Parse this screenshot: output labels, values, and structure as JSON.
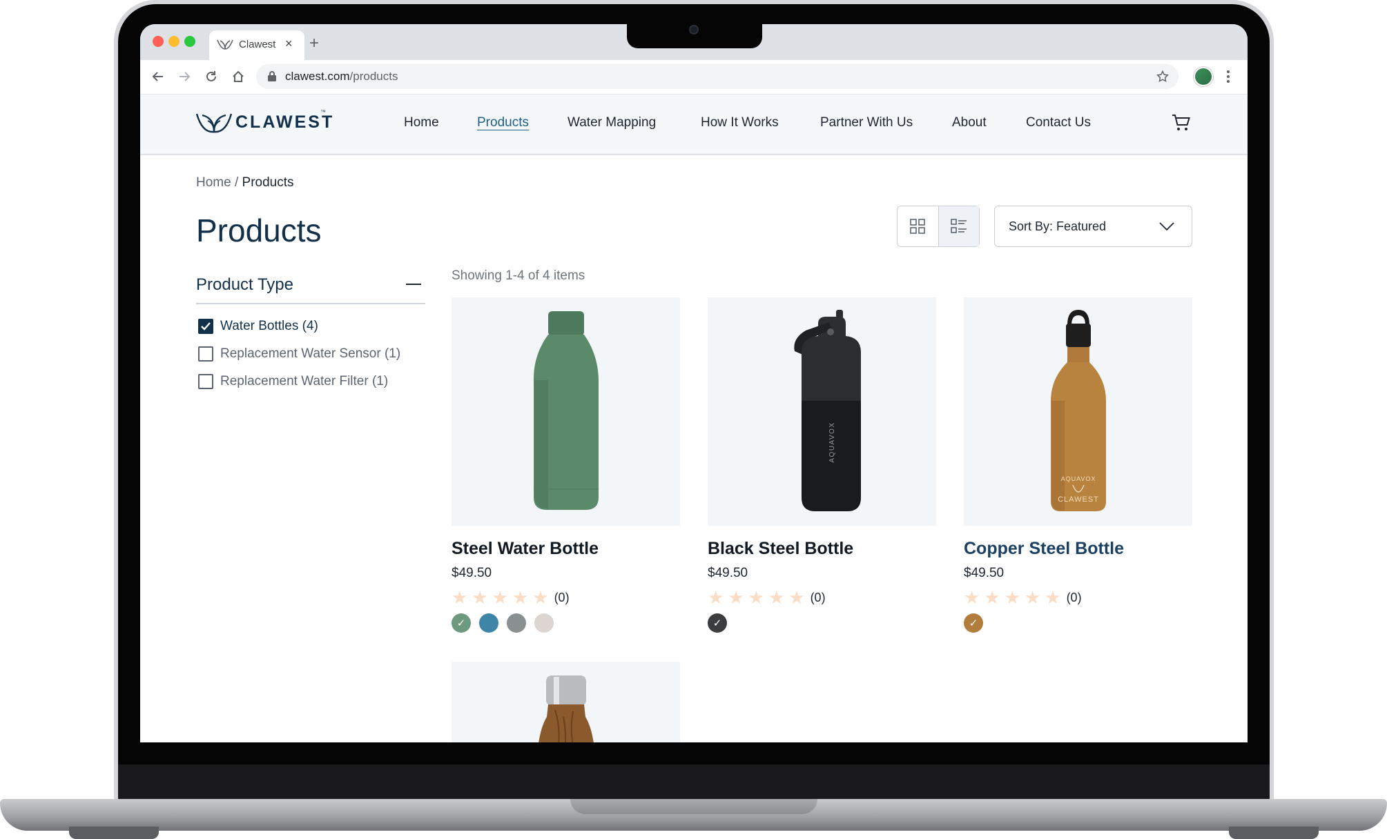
{
  "browser": {
    "tab_title": "Clawest",
    "tab_close": "×",
    "new_tab": "+",
    "url_domain": "clawest.com",
    "url_path": "/products",
    "traffic_colors": [
      "#ff5f57",
      "#febc2e",
      "#28c840"
    ]
  },
  "site": {
    "logo": "CLAWEST",
    "trademark": "™",
    "nav": [
      {
        "label": "Home"
      },
      {
        "label": "Products",
        "active": true
      },
      {
        "label": "Water Mapping"
      },
      {
        "label": "How It Works"
      },
      {
        "label": "Partner With Us"
      },
      {
        "label": "About"
      },
      {
        "label": "Contact Us"
      }
    ],
    "cart_icon": "cart-icon"
  },
  "breadcrumb": {
    "home": "Home",
    "sep": " / ",
    "current": "Products"
  },
  "page_title": "Products",
  "sort": {
    "label": "Sort By: Featured"
  },
  "filter": {
    "title": "Product Type",
    "options": [
      {
        "label": "Water Bottles (4)",
        "checked": true
      },
      {
        "label": "Replacement Water Sensor (1)",
        "checked": false
      },
      {
        "label": "Replacement Water Filter (1)",
        "checked": false
      }
    ]
  },
  "results": {
    "showing": "Showing 1-4 of 4 items"
  },
  "products": [
    {
      "name": "Steel Water Bottle",
      "price": "$49.50",
      "rating_count": "(0)",
      "swatches": [
        "#6d9a7f",
        "#3d86a8",
        "#8a8f90",
        "#dcd5d2"
      ],
      "selected_swatch": 0
    },
    {
      "name": "Black Steel Bottle",
      "price": "$49.50",
      "rating_count": "(0)",
      "swatches": [
        "#3a3c3e"
      ],
      "selected_swatch": 0,
      "bottle_text": "AQUAVOX"
    },
    {
      "name": "Copper Steel Bottle",
      "price": "$49.50",
      "rating_count": "(0)",
      "swatches": [
        "#b17d3c"
      ],
      "selected_swatch": 0,
      "bottle_text_1": "AQUAVOX",
      "bottle_text_2": "CLAWEST"
    }
  ],
  "colors": {
    "brand": "#12304a",
    "accent": "#1f5e86",
    "star": "#fbdcc4"
  }
}
